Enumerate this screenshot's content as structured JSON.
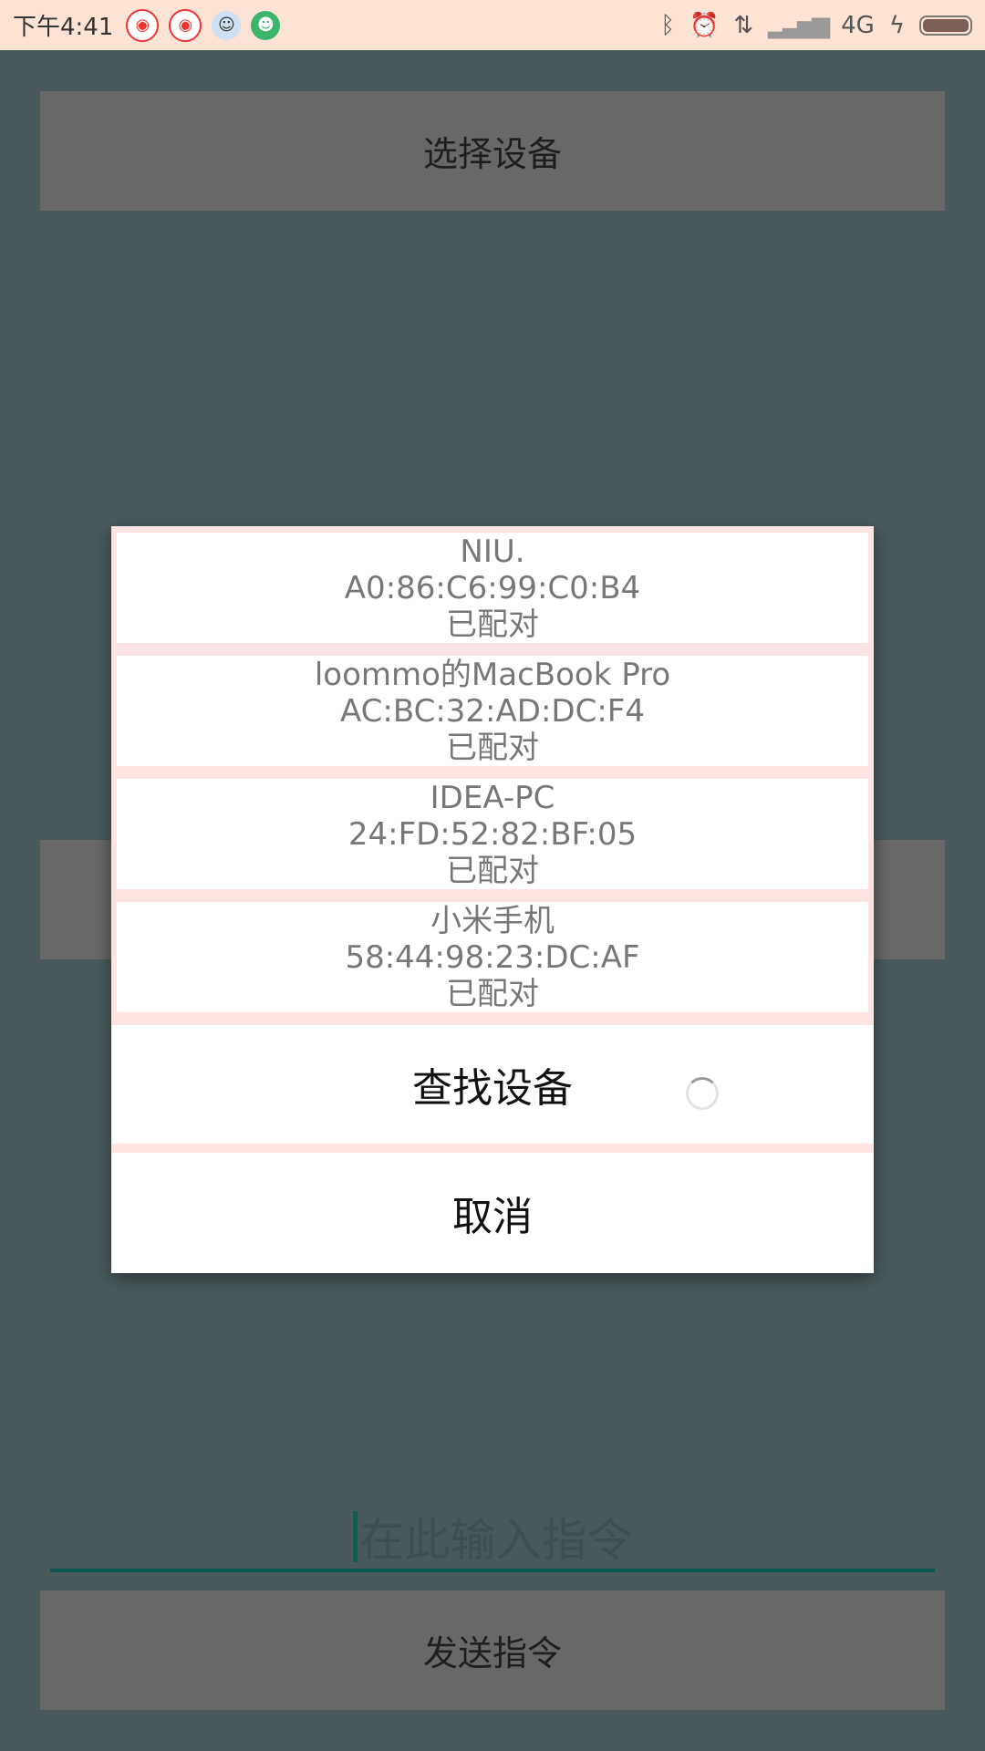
{
  "status_bar": {
    "time": "下午4:41",
    "network": "4G",
    "icons": [
      "weibo-icon",
      "weibo-icon",
      "cartoon-avatar-icon",
      "android-frog-icon",
      "bluetooth-icon",
      "alarm-icon",
      "data-transfer-icon",
      "signal-icon",
      "charging-icon",
      "battery-icon"
    ]
  },
  "main": {
    "select_device_label": "选择设备",
    "command_placeholder": "在此输入指令",
    "send_command_label": "发送指令"
  },
  "dialog": {
    "devices": [
      {
        "name": "NIU.",
        "address": "A0:86:C6:99:C0:B4",
        "status": "已配对"
      },
      {
        "name": "loommo的MacBook Pro",
        "address": "AC:BC:32:AD:DC:F4",
        "status": "已配对"
      },
      {
        "name": "IDEA-PC",
        "address": "24:FD:52:82:BF:05",
        "status": "已配对"
      },
      {
        "name": "小米手机",
        "address": "58:44:98:23:DC:AF",
        "status": "已配对"
      }
    ],
    "search_label": "查找设备",
    "cancel_label": "取消"
  },
  "colors": {
    "status_bar_bg": "#fde3d3",
    "scrim_bg": "#4a5a5c",
    "button_bg": "#686868",
    "accent": "#08574f",
    "dialog_divider": "#fde4e0"
  }
}
